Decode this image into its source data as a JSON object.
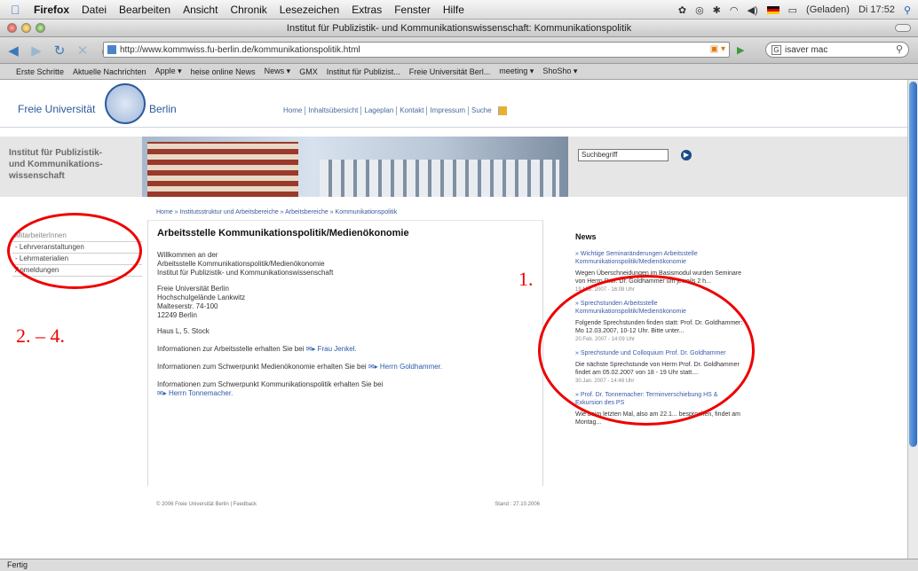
{
  "menubar": {
    "app": "Firefox",
    "items": [
      "Datei",
      "Bearbeiten",
      "Ansicht",
      "Chronik",
      "Lesezeichen",
      "Extras",
      "Fenster",
      "Hilfe"
    ],
    "battery": "(Geladen)",
    "clock": "Di 17:52"
  },
  "window": {
    "title": "Institut für Publizistik- und Kommunikationswissenschaft: Kommunikationspolitik"
  },
  "navbar": {
    "url": "http://www.kommwiss.fu-berlin.de/kommunikationspolitik.html",
    "search_value": "isaver mac"
  },
  "bookmarks": [
    "Erste Schritte",
    "Aktuelle Nachrichten",
    "Apple ▾",
    "heise online News",
    "News ▾",
    "GMX",
    "Institut für Publizist...",
    "Freie Universität Berl...",
    "meeting ▾",
    "ShoSho ▾"
  ],
  "fu": {
    "left": "Freie Universität",
    "right": "Berlin",
    "topnav": [
      "Home",
      "Inhaltsübersicht",
      "Lageplan",
      "Kontakt",
      "Impressum",
      "Suche"
    ]
  },
  "institute": [
    "Institut für Publizistik-",
    "und Kommunikations-",
    "wissenschaft"
  ],
  "site_search": {
    "value": "Suchbegriff"
  },
  "leftnav": [
    "MitarbeiterInnen",
    "- Lehrveranstaltungen",
    "- Lehrmaterialien",
    "Anmeldungen"
  ],
  "breadcrumb": "Home » Institutsstruktur und Arbeitsbereiche » Arbeitsbereiche » Kommunikationspolitik",
  "content": {
    "heading": "Arbeitsstelle Kommunikationspolitik/Medienökonomie",
    "welcome": [
      "Willkommen an der",
      "Arbeitsstelle Kommunikationspolitik/Medienökonomie",
      "Institut für Publizistik- und Kommunikationswissenschaft"
    ],
    "address": [
      "Freie Universität Berlin",
      "Hochschulgelände Lankwitz",
      "Malteserstr. 74-100",
      "12249 Berlin"
    ],
    "house": "Haus L, 5. Stock",
    "info1": "Informationen zur Arbeitsstelle erhalten Sie bei",
    "info1_link": "Frau Jenkel.",
    "info2": "Informationen zum Schwerpunkt Medienökonomie erhalten Sie bei",
    "info2_link": "Herrn Goldhammer.",
    "info3": "Informationen zum Schwerpunkt Kommunikationspolitik erhalten Sie bei",
    "info3_link": "Herrn Tonnemacher."
  },
  "footer": {
    "left": "© 2006 Freie Universität Berlin | Feedback",
    "right": "Stand : 27.10.2006"
  },
  "news": {
    "heading": "News",
    "entries": [
      {
        "title": "» Wichtige Seminaränderungen Arbeitsstelle Kommunikationspolitik/Medienökonomie",
        "teaser": "Wegen Überschneidungen im Basismodul wurden Seminare von Herrn Prof. Dr. Goldhammer um jeweils 2 h...",
        "date": "19.Mär. 2007 - 16:08 Uhr"
      },
      {
        "title": "» Sprechstunden Arbeitsstelle Kommunikationspolitik/Medienökonomie",
        "teaser": "Folgende Sprechstunden finden statt: Prof. Dr. Goldhammer: Mo 12.03.2007, 10-12 Uhr. Bitte unter...",
        "date": "20.Feb. 2007 - 14:09 Uhr"
      },
      {
        "title": "» Sprechstunde und Colloquium Prof. Dr. Goldhammer",
        "teaser": "Die nächste Sprechstunde von Herrn Prof. Dr. Goldhammer findet am 05.02.2007 von 18 - 19 Uhr statt....",
        "date": "30.Jan. 2007 - 14:48 Uhr"
      },
      {
        "title": "» Prof. Dr. Tonnemacher: Terminverschiebung HS & Exkursion des PS",
        "teaser": "Wie beim letzten Mal, also am 22.1... besprochen, findet am Montag...",
        "date": ""
      }
    ]
  },
  "annotations": {
    "label1": "1.",
    "label2": "2. – 4."
  },
  "status": "Fertig",
  "colors": {
    "annotation": "#e00000",
    "fu_blue": "#2a5a9a",
    "link": "#2a5aa8"
  }
}
